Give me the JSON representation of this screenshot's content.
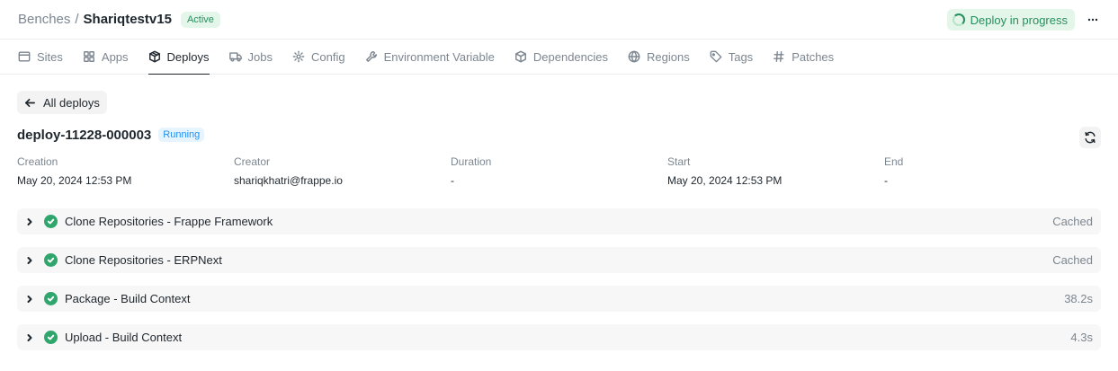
{
  "breadcrumb": {
    "root": "Benches",
    "separator": "/",
    "current": "Shariqtestv15",
    "status_badge": "Active"
  },
  "header_actions": {
    "deploy_status": "Deploy in progress",
    "more_icon": "more-horizontal-icon"
  },
  "tabs": [
    {
      "label": "Sites",
      "icon": "browser-icon",
      "active": false
    },
    {
      "label": "Apps",
      "icon": "grid-icon",
      "active": false
    },
    {
      "label": "Deploys",
      "icon": "package-icon",
      "active": true
    },
    {
      "label": "Jobs",
      "icon": "truck-icon",
      "active": false
    },
    {
      "label": "Config",
      "icon": "gear-icon",
      "active": false
    },
    {
      "label": "Environment Variable",
      "icon": "wrench-icon",
      "active": false
    },
    {
      "label": "Dependencies",
      "icon": "box-icon",
      "active": false
    },
    {
      "label": "Regions",
      "icon": "globe-icon",
      "active": false
    },
    {
      "label": "Tags",
      "icon": "tag-icon",
      "active": false
    },
    {
      "label": "Patches",
      "icon": "hash-icon",
      "active": false
    }
  ],
  "back": {
    "label": "All deploys"
  },
  "deploy": {
    "name": "deploy-11228-000003",
    "status": "Running"
  },
  "meta": [
    {
      "label": "Creation",
      "value": "May 20, 2024 12:53 PM"
    },
    {
      "label": "Creator",
      "value": "shariqkhatri@frappe.io"
    },
    {
      "label": "Duration",
      "value": "-"
    },
    {
      "label": "Start",
      "value": "May 20, 2024 12:53 PM"
    },
    {
      "label": "End",
      "value": "-"
    }
  ],
  "steps": [
    {
      "title": "Clone Repositories - Frappe Framework",
      "status": "Cached"
    },
    {
      "title": "Clone Repositories - ERPNext",
      "status": "Cached"
    },
    {
      "title": "Package - Build Context",
      "status": "38.2s"
    },
    {
      "title": "Upload - Build Context",
      "status": "4.3s"
    }
  ],
  "colors": {
    "accent_green": "#278f5e",
    "success_green": "#30a66d",
    "running_blue": "#2490ef"
  }
}
